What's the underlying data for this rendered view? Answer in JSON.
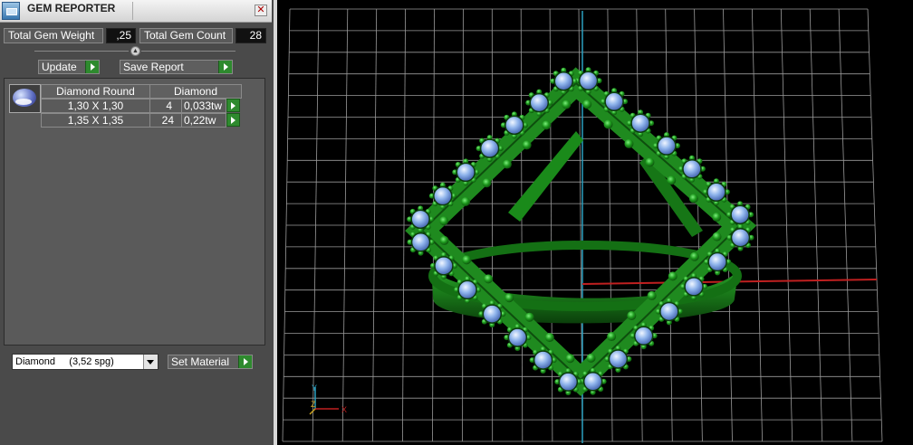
{
  "window": {
    "title": "GEM REPORTER",
    "close_icon": "close-icon"
  },
  "summary": {
    "total_weight_label": "Total Gem Weight",
    "total_weight_value": ",25",
    "total_count_label": "Total Gem Count",
    "total_count_value": "28"
  },
  "toolbar": {
    "update_label": "Update",
    "save_report_label": "Save Report"
  },
  "gem_table": {
    "shape_header": "Diamond Round",
    "material_header": "Diamond",
    "rows": [
      {
        "size": "1,30 X 1,30",
        "count": "4",
        "weight": "0,033tw"
      },
      {
        "size": "1,35 X 1,35",
        "count": "24",
        "weight": "0,22tw"
      }
    ]
  },
  "material": {
    "selected": "Diamond     (3,52 spg)",
    "set_label": "Set Material"
  },
  "viewport": {
    "axis_labels": {
      "y": "Y",
      "z": "Z",
      "x": "X"
    },
    "colors": {
      "grid": "#9a9a9a",
      "metal": "#1f8a1f",
      "gem": "#8fb4ec",
      "axis_x": "#c02020",
      "axis_y": "#2aa0c0"
    }
  }
}
